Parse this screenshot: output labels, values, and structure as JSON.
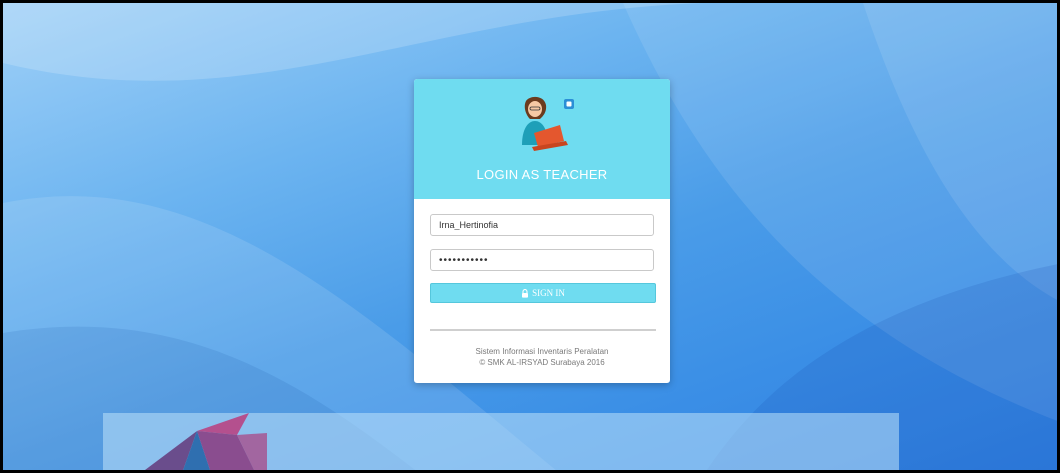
{
  "login": {
    "title": "LOGIN AS TEACHER",
    "username_value": "Irna_Hertinofia",
    "password_value": "•••••••••••",
    "signin_label": "SIGN IN",
    "footer_line1": "Sistem Informasi Inventaris Peralatan",
    "footer_line2": "© SMK AL-IRSYAD Surabaya 2016"
  },
  "icons": {
    "avatar": "teacher-avatar-icon",
    "lock": "lock-icon",
    "logo": "institution-logo"
  },
  "colors": {
    "header": "#6fdcf0",
    "button": "#6fdcf0",
    "background": "#4a9ce8"
  }
}
